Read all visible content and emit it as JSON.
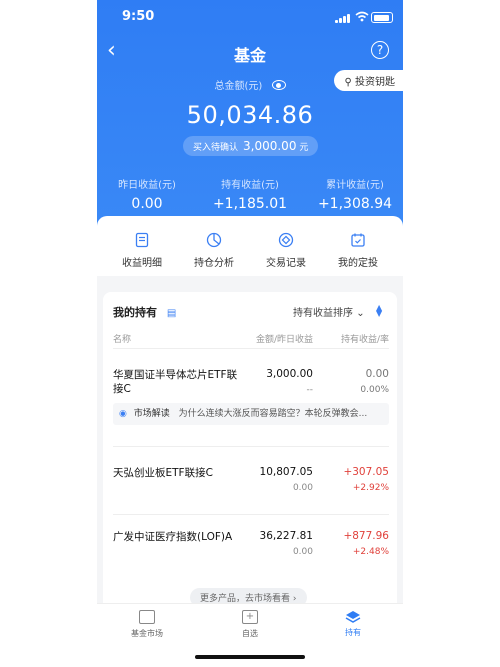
{
  "status": {
    "time": "9:50"
  },
  "nav": {
    "title": "基金",
    "back_icon": "chevron-left-icon",
    "help": "?"
  },
  "invest_key": "投资钥匙",
  "summary": {
    "total_label": "总金额(元)",
    "total": "50,034.86",
    "pending_label": "买入待确认",
    "pending_amount": "3,000.00",
    "pending_unit": "元",
    "stats": [
      {
        "label": "昨日收益(元)",
        "value": "0.00"
      },
      {
        "label": "持有收益(元)",
        "value": "+1,185.01"
      },
      {
        "label": "累计收益(元)",
        "value": "+1,308.94"
      }
    ]
  },
  "quick_actions": [
    {
      "label": "收益明细",
      "icon": "document-icon"
    },
    {
      "label": "持仓分析",
      "icon": "pie-chart-icon"
    },
    {
      "label": "交易记录",
      "icon": "target-icon"
    },
    {
      "label": "我的定投",
      "icon": "calendar-icon"
    }
  ],
  "holdings": {
    "title": "我的持有",
    "sort_label": "持有收益排序",
    "columns": [
      "名称",
      "金额/昨日收益",
      "持有收益/率"
    ],
    "funds": [
      {
        "name": "华夏国证半导体芯片ETF联接C",
        "amount": "3,000.00",
        "yesterday": "--",
        "profit": "0.00",
        "rate": "0.00%"
      },
      {
        "name": "天弘创业板ETF联接C",
        "amount": "10,807.05",
        "yesterday": "0.00",
        "profit": "+307.05",
        "rate": "+2.92%"
      },
      {
        "name": "广发中证医疗指数(LOF)A",
        "amount": "36,227.81",
        "yesterday": "0.00",
        "profit": "+877.96",
        "rate": "+2.48%"
      }
    ],
    "market_tag": "市场解读",
    "market_text": "为什么连续大涨反而容易踏空？本轮反弹教会..."
  },
  "more_link": "更多产品，去市场看看",
  "tabs": [
    {
      "label": "基金市场"
    },
    {
      "label": "自选"
    },
    {
      "label": "持有"
    }
  ],
  "colors": {
    "primary": "#2f7df4",
    "profit_red": "#e0413b"
  }
}
